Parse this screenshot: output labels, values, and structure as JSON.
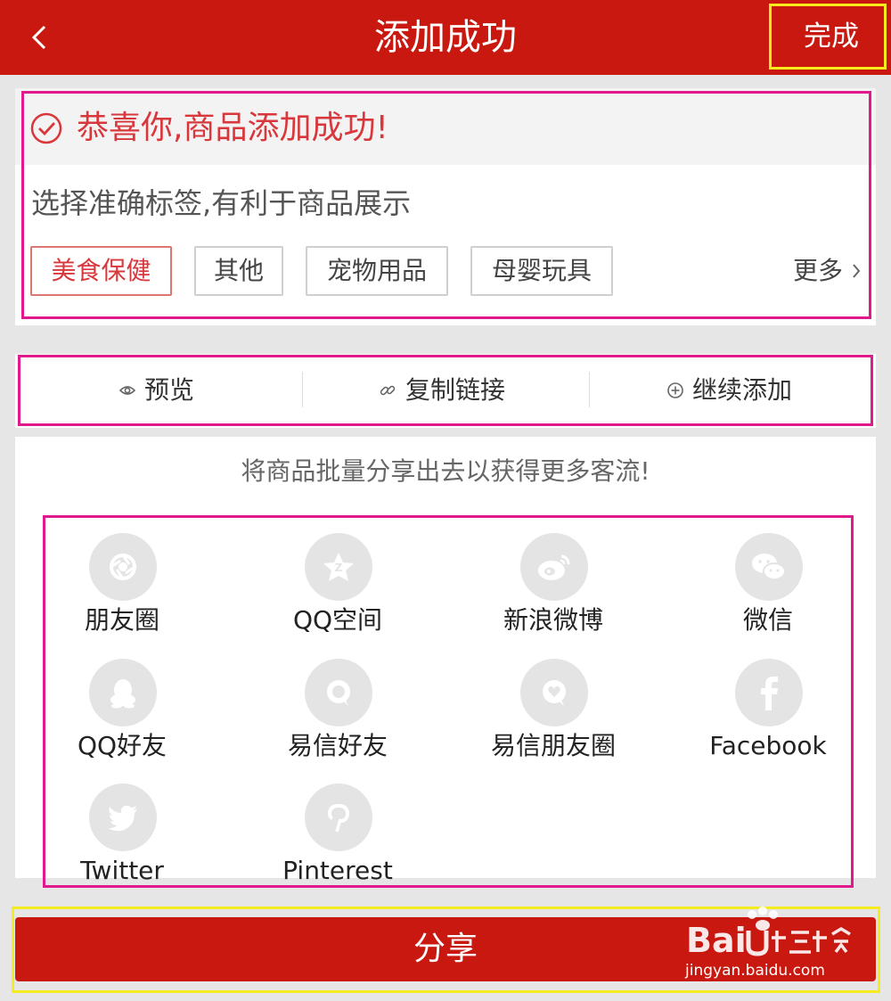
{
  "header": {
    "title": "添加成功",
    "done_label": "完成"
  },
  "success_card": {
    "message": "恭喜你,商品添加成功!",
    "hint": "选择准确标签,有利于商品展示",
    "tags": [
      {
        "label": "美食保健",
        "selected": true
      },
      {
        "label": "其他",
        "selected": false
      },
      {
        "label": "宠物用品",
        "selected": false
      },
      {
        "label": "母婴玩具",
        "selected": false
      }
    ],
    "more_label": "更多"
  },
  "actions": [
    {
      "label": "预览",
      "icon": "eye-icon"
    },
    {
      "label": "复制链接",
      "icon": "link-icon"
    },
    {
      "label": "继续添加",
      "icon": "plus-circle-icon"
    }
  ],
  "share": {
    "hint": "将商品批量分享出去以获得更多客流!",
    "items": [
      {
        "label": "朋友圈",
        "icon": "moments-icon"
      },
      {
        "label": "QQ空间",
        "icon": "qzone-icon"
      },
      {
        "label": "新浪微博",
        "icon": "weibo-icon"
      },
      {
        "label": "微信",
        "icon": "wechat-icon"
      },
      {
        "label": "QQ好友",
        "icon": "qq-icon"
      },
      {
        "label": "易信好友",
        "icon": "yixin-icon"
      },
      {
        "label": "易信朋友圈",
        "icon": "yixin-moments-icon"
      },
      {
        "label": "Facebook",
        "icon": "facebook-icon"
      },
      {
        "label": "Twitter",
        "icon": "twitter-icon"
      },
      {
        "label": "Pinterest",
        "icon": "pinterest-icon"
      }
    ],
    "button_label": "分享"
  },
  "watermark": {
    "text": "jingyan.baidu.com",
    "logo_text": "Baidu经验"
  },
  "colors": {
    "brand": "#c8180f",
    "accent": "#d8383c",
    "annotation_pink": "#e0198c",
    "annotation_yellow": "#f6ec1d",
    "icon_bg": "#e4e4e4"
  }
}
